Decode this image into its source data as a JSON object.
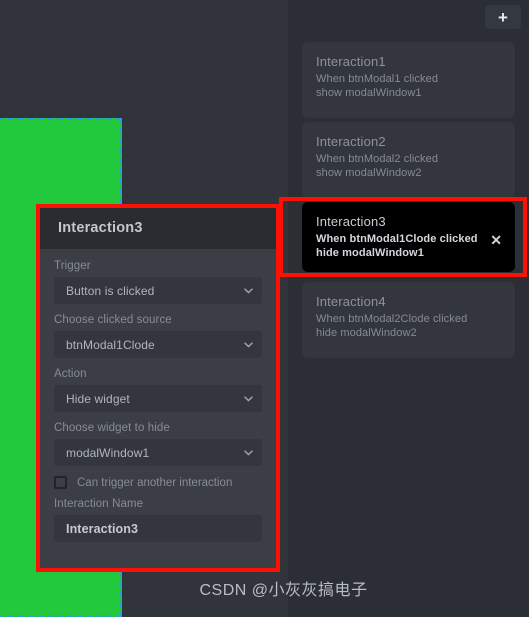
{
  "colors": {
    "canvas_bg": "#31343b",
    "panel_bg": "#2b2e34",
    "dialog_bg": "#3b3e45",
    "dialog_header_bg": "#2a2c31",
    "card_bg": "#33363d",
    "card_selected_bg": "#000000",
    "annotation_red": "#fe1005",
    "widget_green": "#22c93c",
    "selection_blue": "#2f9ae0"
  },
  "canvas": {
    "widget_name": "green-rectangle-widget"
  },
  "panel": {
    "add_button_label": "+",
    "add_button_icon": "plus-icon",
    "cards": [
      {
        "title": "Interaction1",
        "line1": "When btnModal1 clicked",
        "line2": "show modalWindow1",
        "selected": false
      },
      {
        "title": "Interaction2",
        "line1": "When btnModal2 clicked",
        "line2": "show modalWindow2",
        "selected": false
      },
      {
        "title": "Interaction3",
        "line1": "When btnModal1Clode clicked",
        "line2": "hide modalWindow1",
        "selected": true,
        "close_icon": "close-icon",
        "close_label": "✕"
      },
      {
        "title": "Interaction4",
        "line1": "When btnModal2Clode clicked",
        "line2": "hide modalWindow2",
        "selected": false
      }
    ]
  },
  "dialog": {
    "title": "Interaction3",
    "fields": {
      "trigger_label": "Trigger",
      "trigger_value": "Button is clicked",
      "source_label": "Choose clicked source",
      "source_value": "btnModal1Clode",
      "action_label": "Action",
      "action_value": "Hide widget",
      "widget_label": "Choose widget to hide",
      "widget_value": "modalWindow1",
      "chain_checkbox_label": "Can trigger another interaction",
      "chain_checkbox_checked": false,
      "name_label": "Interaction Name",
      "name_value": "Interaction3"
    }
  },
  "watermark": {
    "text": "CSDN @小灰灰搞电子"
  }
}
